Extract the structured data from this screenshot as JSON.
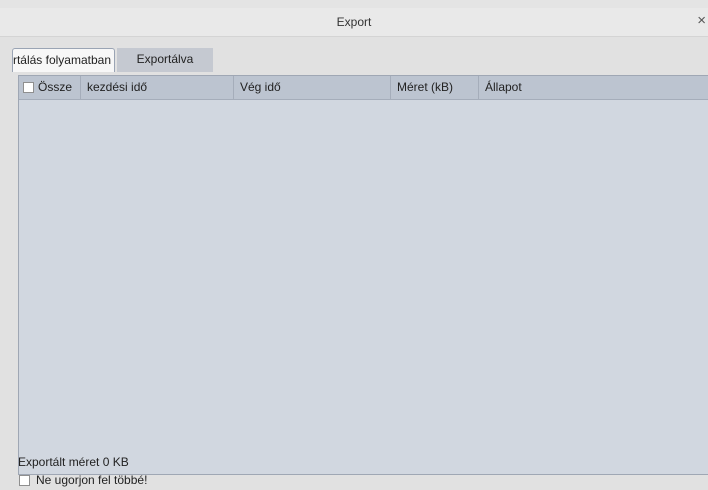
{
  "window": {
    "title": "Export",
    "close_glyph": "×"
  },
  "tabs": [
    {
      "label": "Exportálás folyamatban",
      "active": true
    },
    {
      "label": "Exportálva",
      "active": false
    }
  ],
  "table": {
    "columns": [
      "Össze",
      "kezdési idő",
      "Vég idő",
      "Méret (kB)",
      "Állapot"
    ],
    "rows": []
  },
  "footer": {
    "export_size": "Exportált méret 0 KB",
    "dont_show_again": "Ne ugorjon fel többé!"
  },
  "colors": {
    "table_body": "#d1d7e0",
    "table_header": "#bcc4d0",
    "active_tab": "#f7f7f7",
    "inactive_tab": "#c5c9d1"
  }
}
